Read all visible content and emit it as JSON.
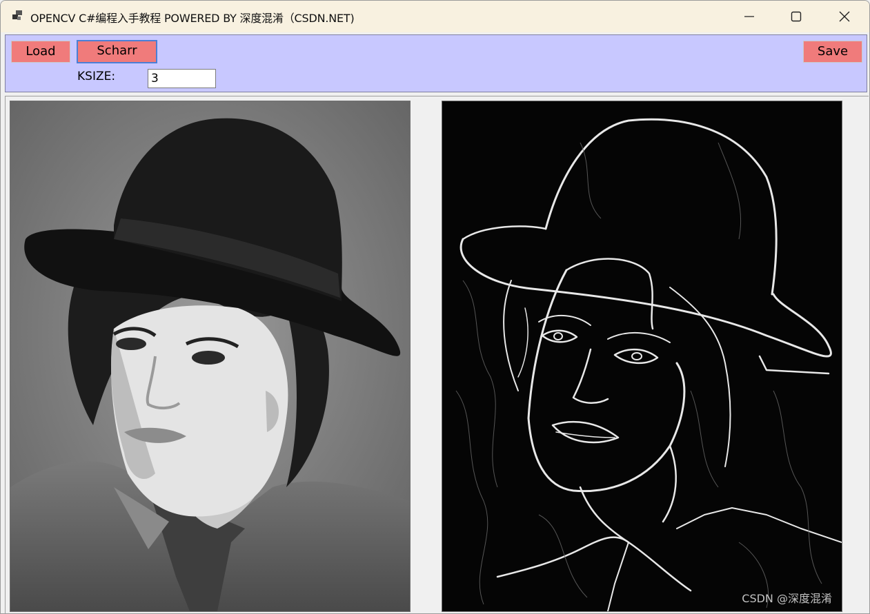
{
  "window": {
    "title": "OPENCV C#编程入手教程 POWERED BY 深度混淆（CSDN.NET)",
    "icon": "app-window-icon",
    "controls": [
      "minimize-icon",
      "maximize-icon",
      "close-icon"
    ]
  },
  "toolbar": {
    "load_label": "Load",
    "scharr_label": "Scharr",
    "save_label": "Save",
    "ksize_label": "KSIZE:",
    "ksize_value": "3",
    "background": "#c8c8ff",
    "button_color": "#f07b7b"
  },
  "images": {
    "source": "grayscale-portrait-photo",
    "result": "scharr-edge-detection-output"
  },
  "watermark": "CSDN @深度混淆"
}
